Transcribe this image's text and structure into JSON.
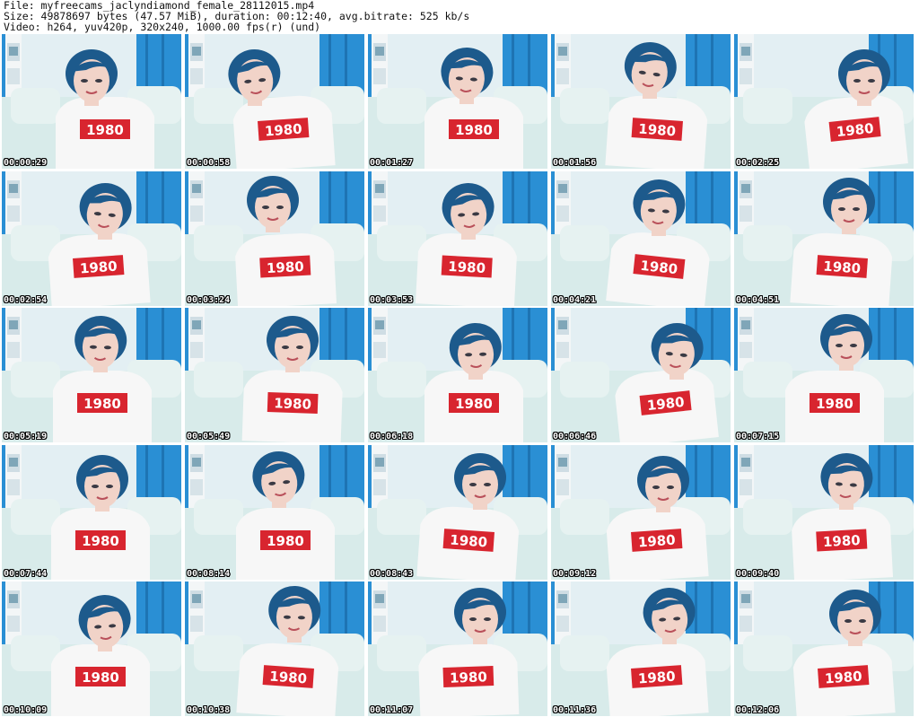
{
  "header": {
    "file_line": "File: myfreecams_jaclyndiamond_female_28112015.mp4",
    "size_line": "Size: 49878697 bytes (47.57 MiB), duration: 00:12:40, avg.bitrate: 525 kb/s",
    "video_line": "Video: h264, yuv420p, 320x240, 1000.00 fps(r) (und)"
  },
  "shirt_text": "1980",
  "colors": {
    "wall_blue": "#2a8fd4",
    "couch": "#d8ebea",
    "shirt": "#f7f7f7",
    "shirt_print": "#d8252f",
    "hair": "#1d5a8c",
    "skin": "#f1d3c8"
  },
  "thumbnails": [
    {
      "time": "00:00:29"
    },
    {
      "time": "00:00:58"
    },
    {
      "time": "00:01:27"
    },
    {
      "time": "00:01:56"
    },
    {
      "time": "00:02:25"
    },
    {
      "time": "00:02:54"
    },
    {
      "time": "00:03:24"
    },
    {
      "time": "00:03:53"
    },
    {
      "time": "00:04:21"
    },
    {
      "time": "00:04:51"
    },
    {
      "time": "00:05:19"
    },
    {
      "time": "00:05:49"
    },
    {
      "time": "00:06:18"
    },
    {
      "time": "00:06:46"
    },
    {
      "time": "00:07:15"
    },
    {
      "time": "00:07:44"
    },
    {
      "time": "00:08:14"
    },
    {
      "time": "00:08:43"
    },
    {
      "time": "00:09:12"
    },
    {
      "time": "00:09:40"
    },
    {
      "time": "00:10:09"
    },
    {
      "time": "00:10:38"
    },
    {
      "time": "00:11:07"
    },
    {
      "time": "00:11:36"
    },
    {
      "time": "00:12:06"
    }
  ]
}
